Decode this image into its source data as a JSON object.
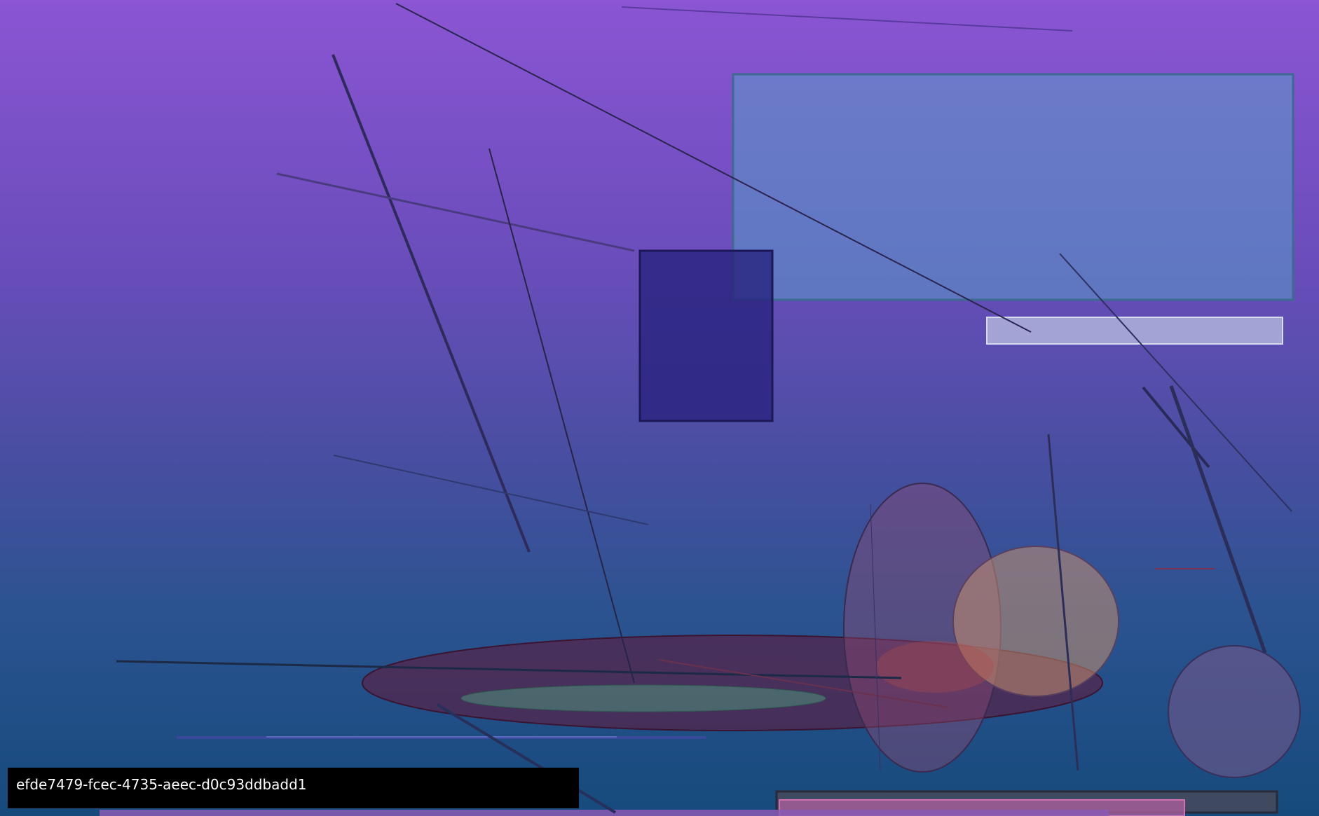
{
  "caption": {
    "id_text": "efde7479-fcec-4735-aeec-d0c93ddbadd1"
  },
  "colors": {
    "background_top": "#8b55d3",
    "background_bottom": "#164a7c",
    "big_rect_fill": "#5a8ac4",
    "dark_rect_fill": "#2d2b86",
    "light_bar_fill": "#b4bcdc",
    "line_stroke": "#2a2450",
    "ellipse_dark": "#5a2040",
    "ellipse_teal": "#4a7a6a",
    "ellipse_peach": "#b08870",
    "circle_slate": "#6a5a8a",
    "caption_bg": "#000000",
    "caption_text": "#ffffff"
  }
}
